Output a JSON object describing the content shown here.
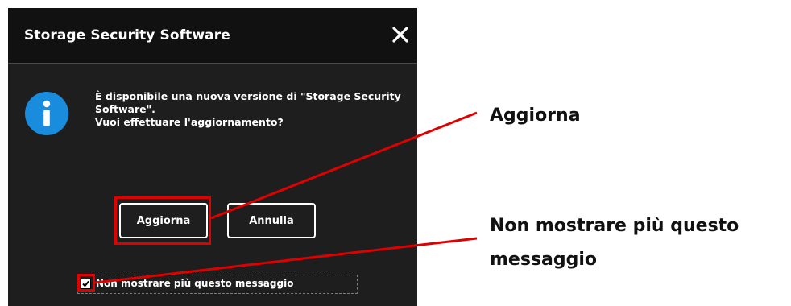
{
  "dialog": {
    "title": "Storage Security Software",
    "message_line1": "È disponibile una nuova versione di \"Storage Security",
    "message_line2": "Software\".",
    "message_line3": "Vuoi effettuare l'aggiornamento?",
    "update_label": "Aggiorna",
    "cancel_label": "Annulla",
    "checkbox_label": "Non mostrare più questo messaggio",
    "checkbox_checked": true
  },
  "annotations": {
    "update_label": "Aggiorna",
    "checkbox_label_line1": "Non mostrare più questo",
    "checkbox_label_line2": "messaggio"
  },
  "colors": {
    "dialog_bg": "#1e1e1e",
    "titlebar_bg": "#111111",
    "info_icon": "#1a8cdd",
    "highlight": "#e00000"
  }
}
